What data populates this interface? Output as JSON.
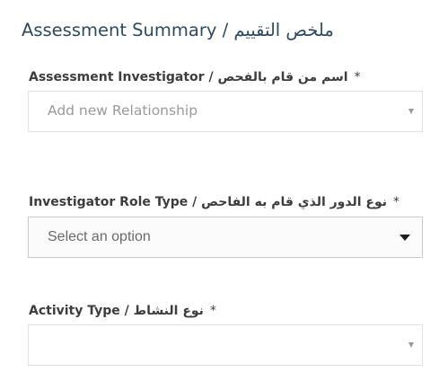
{
  "section": {
    "title": "Assessment Summary / ملخص التقييم"
  },
  "fields": [
    {
      "label": "Assessment Investigator / اسم من قام بالفحص",
      "required_mark": "*",
      "value": "Add new Relationship"
    },
    {
      "label": "Investigator Role Type / نوع الدور الذي قام به الفاحص",
      "required_mark": "*",
      "value": "Select an option"
    },
    {
      "label": "Activity Type / نوع النشاط",
      "required_mark": "*",
      "value": ""
    }
  ],
  "icons": {
    "dropdown": "chevron-down-icon"
  }
}
